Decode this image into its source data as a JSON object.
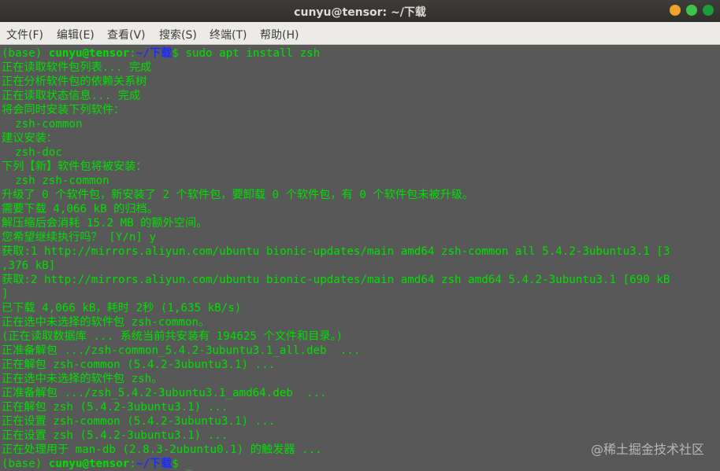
{
  "window": {
    "title": "cunyu@tensor: ~/下载",
    "colors": {
      "close": "#f0a22a",
      "minimize": "#3ec34a",
      "maximize": "#1b9e3a"
    }
  },
  "menu": [
    "文件(F)",
    "编辑(E)",
    "查看(V)",
    "搜索(S)",
    "终端(T)",
    "帮助(H)"
  ],
  "terminal": {
    "prompt": {
      "env": "(base) ",
      "user": "cunyu@tensor",
      "sep": ":",
      "path": "~/下载",
      "dollar": "$ ",
      "command": "sudo apt install zsh"
    },
    "lines": [
      "正在读取软件包列表... 完成",
      "正在分析软件包的依赖关系树",
      "正在读取状态信息... 完成",
      "将会同时安装下列软件：",
      "  zsh-common",
      "建议安装：",
      "  zsh-doc",
      "下列【新】软件包将被安装：",
      "  zsh zsh-common",
      "升级了 0 个软件包，新安装了 2 个软件包，要卸载 0 个软件包，有 0 个软件包未被升级。",
      "需要下载 4,066 kB 的归档。",
      "解压缩后会消耗 15.2 MB 的额外空间。",
      "您希望继续执行吗？ [Y/n] y",
      "获取:1 http://mirrors.aliyun.com/ubuntu bionic-updates/main amd64 zsh-common all 5.4.2-3ubuntu3.1 [3",
      ",376 kB]",
      "获取:2 http://mirrors.aliyun.com/ubuntu bionic-updates/main amd64 zsh amd64 5.4.2-3ubuntu3.1 [690 kB",
      "]",
      "已下载 4,066 kB，耗时 2秒 (1,635 kB/s)",
      "正在选中未选择的软件包 zsh-common。",
      "(正在读取数据库 ... 系统当前共安装有 194625 个文件和目录。)",
      "正准备解包 .../zsh-common_5.4.2-3ubuntu3.1_all.deb  ...",
      "正在解包 zsh-common (5.4.2-3ubuntu3.1) ...",
      "正在选中未选择的软件包 zsh。",
      "正准备解包 .../zsh_5.4.2-3ubuntu3.1_amd64.deb  ...",
      "正在解包 zsh (5.4.2-3ubuntu3.1) ...",
      "正在设置 zsh-common (5.4.2-3ubuntu3.1) ...",
      "正在设置 zsh (5.4.2-3ubuntu3.1) ...",
      "正在处理用于 man-db (2.8.3-2ubuntu0.1) 的触发器 ..."
    ],
    "cursor": "_"
  },
  "watermark": "@稀土掘金技术社区"
}
